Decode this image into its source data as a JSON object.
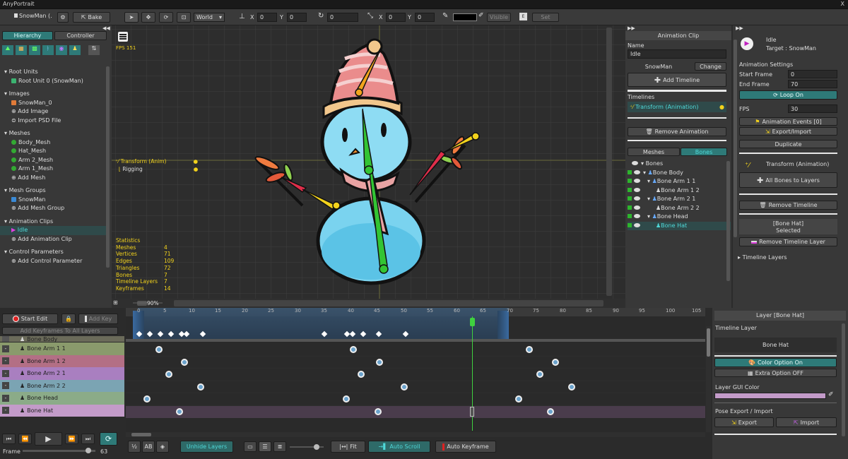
{
  "app": {
    "title": "AnyPortrait",
    "close": "X"
  },
  "toolbar": {
    "portrait": "SnowMan (.",
    "bake": "Bake",
    "space": "World",
    "x_label": "X",
    "x_value": "0",
    "y_label": "Y",
    "y_value": "0",
    "rot_value": "0",
    "sx_label": "X",
    "sx_value": "0",
    "sy_label": "Y",
    "sy_value": "0",
    "visible": "Visible",
    "set": "Set"
  },
  "left": {
    "tab_hierarchy": "Hierarchy",
    "tab_controller": "Controller",
    "sections": [
      {
        "title": "Root Units",
        "items": [
          "Root Unit 0 (SnowMan)"
        ]
      },
      {
        "title": "Images",
        "items": [
          "SnowMan_0",
          "Add Image",
          "Import PSD File"
        ]
      },
      {
        "title": "Meshes",
        "items": [
          "Body_Mesh",
          "Hat_Mesh",
          "Arm 2_Mesh",
          "Arm 1_Mesh",
          "Add Mesh"
        ]
      },
      {
        "title": "Mesh Groups",
        "items": [
          "SnowMan",
          "Add Mesh Group"
        ]
      },
      {
        "title": "Animation Clips",
        "items": [
          "Idle",
          "Add Animation Clip"
        ]
      },
      {
        "title": "Control Parameters",
        "items": [
          "Add Control Parameter"
        ]
      }
    ]
  },
  "viewport": {
    "fps": "FPS 151",
    "layer1": "Transform (Anim)",
    "layer2": "Rigging",
    "zoom": "90%",
    "stats_title": "Statistics",
    "stats": [
      [
        "Meshes",
        "4"
      ],
      [
        "Vertices",
        "71"
      ],
      [
        "Edges",
        "109"
      ],
      [
        "Triangles",
        "72"
      ],
      [
        "Bones",
        "7"
      ],
      [
        "Timeline Layers",
        "7"
      ],
      [
        "Keyframes",
        "14"
      ]
    ]
  },
  "anim_panel": {
    "title": "Animation Clip",
    "name_label": "Name",
    "name_value": "Idle",
    "target": "SnowMan",
    "change": "Change",
    "add_timeline": "Add Timeline",
    "timelines_label": "Timelines",
    "timeline_item": "Transform (Animation)",
    "remove_animation": "Remove Animation",
    "tab_meshes": "Meshes",
    "tab_bones": "Bones",
    "bones": [
      "Bones",
      "Bone Body",
      "Bone Arm 1 1",
      "Bone Arm 1 2",
      "Bone Arm 2 1",
      "Bone Arm 2 2",
      "Bone Head",
      "Bone Hat"
    ]
  },
  "right": {
    "clip_name": "Idle",
    "target": "Target : SnowMan",
    "settings": "Animation Settings",
    "start_label": "Start Frame",
    "start_value": "0",
    "end_label": "End Frame",
    "end_value": "70",
    "loop": "Loop On",
    "fps_label": "FPS",
    "fps_value": "30",
    "events": "Animation Events [0]",
    "export_import": "Export/Import",
    "duplicate": "Duplicate",
    "timeline_title": "Transform (Animation)",
    "all_bones": "All Bones to Layers",
    "remove_timeline": "Remove Timeline",
    "selected_bone": "[Bone Hat]",
    "selected": "Selected",
    "remove_layer": "Remove Timeline Layer",
    "timeline_layers": "Timeline Layers"
  },
  "timeline": {
    "start_edit": "Start Edit",
    "add_key": "Add Key",
    "add_all": "Add Keyframes To All Layers",
    "ruler": [
      "0",
      "5",
      "10",
      "15",
      "20",
      "25",
      "30",
      "35",
      "40",
      "45",
      "50",
      "55",
      "60",
      "65",
      "70",
      "75",
      "80",
      "85",
      "90",
      "95",
      "100",
      "105"
    ],
    "tracks": [
      "Bone Body",
      "Bone Arm 1 1",
      "Bone Arm 1 2",
      "Bone Arm 2 1",
      "Bone Arm 2 2",
      "Bone Head",
      "Bone Hat"
    ],
    "frame_label": "Frame",
    "frame_value": "63",
    "unhide": "Unhide Layers",
    "fit": "Fit",
    "auto_scroll": "Auto Scroll",
    "auto_keyframe": "Auto Keyframe"
  },
  "layer_panel": {
    "title": "Layer [Bone Hat]",
    "timeline_layer": "Timeline Layer",
    "layer_name": "Bone Hat",
    "color_option": "Color Option On",
    "extra_option": "Extra Option OFF",
    "gui_color_label": "Layer GUI Color",
    "pose_label": "Pose Export / Import",
    "export": "Export",
    "import": "Import"
  },
  "colors": {
    "accent": "#2e7a78",
    "selected_text": "#4fd9d9",
    "bone_green": "#33c433",
    "bone_yellow": "#f2d21c"
  }
}
